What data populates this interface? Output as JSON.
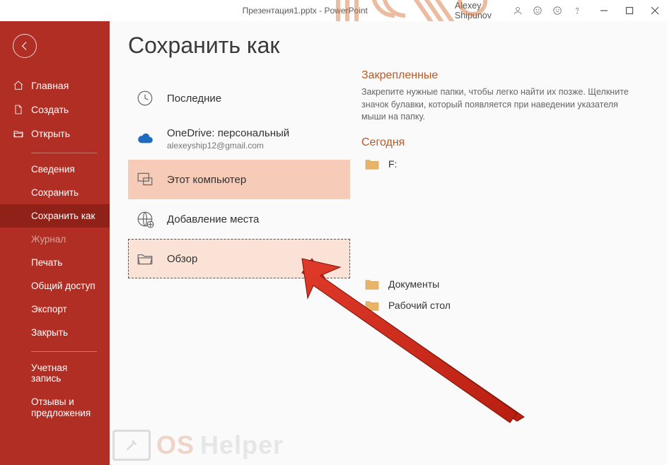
{
  "titlebar": {
    "filename": "Презентация1.pptx",
    "appname": "PowerPoint",
    "user": "Alexey Shipunov"
  },
  "sidebar": {
    "home": "Главная",
    "new": "Создать",
    "open": "Открыть",
    "info": "Сведения",
    "save": "Сохранить",
    "saveas": "Сохранить как",
    "history": "Журнал",
    "print": "Печать",
    "share": "Общий доступ",
    "export": "Экспорт",
    "close": "Закрыть",
    "account": "Учетная запись",
    "feedback": "Отзывы и предложения"
  },
  "page": {
    "title": "Сохранить как"
  },
  "locations": {
    "recent": "Последние",
    "onedrive_title": "OneDrive: персональный",
    "onedrive_sub": "alexeyship12@gmail.com",
    "thispc": "Этот компьютер",
    "addplace": "Добавление места",
    "browse": "Обзор"
  },
  "right": {
    "pinned_head": "Закрепленные",
    "pinned_desc": "Закрепите нужные папки, чтобы легко найти их позже. Щелкните значок булавки, который появляется при наведении указателя мыши на папку.",
    "today_head": "Сегодня",
    "drive_f": "F:",
    "documents": "Документы",
    "desktop": "Рабочий стол"
  },
  "watermark": {
    "t1": "OS",
    "t2": "Helper"
  }
}
